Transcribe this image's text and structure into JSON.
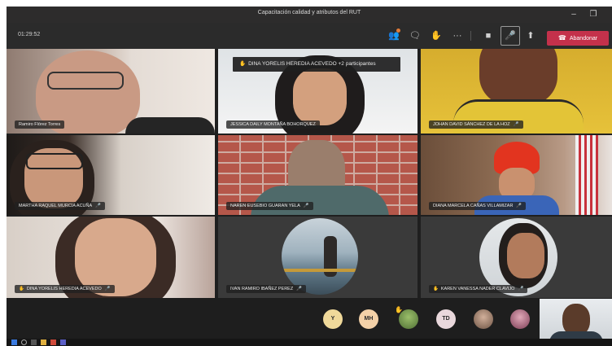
{
  "window": {
    "title": "Capacitación calidad y atributos del RUT"
  },
  "toolbar": {
    "timer": "01:29:52",
    "leave_label": "Abandonar",
    "leave_color": "#c4314b",
    "icons": [
      "participants-icon",
      "chat-icon",
      "raise-hand-icon",
      "more-options-icon",
      "camera-icon",
      "mic-off-icon",
      "share-screen-icon",
      "phone-icon"
    ]
  },
  "banner": {
    "text": "DINA YORELIS HEREDIA ACEVEDO +2 participantes"
  },
  "participants": [
    {
      "name": "Ramiro Flórez Torres",
      "muted": false,
      "hand": false
    },
    {
      "name": "JESSICA DAILY MONTAÑA BOHORQUEZ",
      "muted": false,
      "hand": false
    },
    {
      "name": "JOHAN DAVID SÁNCHEZ DE LA HOZ",
      "muted": true,
      "hand": false
    },
    {
      "name": "MARTHA RAQUEL MURCIA ACUÑA",
      "muted": true,
      "hand": false
    },
    {
      "name": "NAREN EUSEBIO GUARAN YELA",
      "muted": true,
      "hand": false
    },
    {
      "name": "DIANA MARCELA CAÑAS VILLAMIZAR",
      "muted": true,
      "hand": false
    },
    {
      "name": "DINA YORELIS HEREDIA ACEVEDO",
      "muted": true,
      "hand": true
    },
    {
      "name": "IVAN RAMIRO IBAÑEZ PEREZ",
      "muted": true,
      "hand": false
    },
    {
      "name": "KAREN VANESSA NADER CLAVIJO",
      "muted": true,
      "hand": true
    }
  ],
  "overflow_avatars": [
    {
      "initials": "Y",
      "color": "#f0d99a",
      "kind": "initials"
    },
    {
      "initials": "MH",
      "color": "#f3d1a8",
      "kind": "initials"
    },
    {
      "initials": "",
      "color": "#6f8f4a",
      "kind": "photo",
      "hand": true
    },
    {
      "initials": "TD",
      "color": "#e9d8dc",
      "kind": "initials"
    },
    {
      "initials": "",
      "color": "#a88a76",
      "kind": "photo"
    },
    {
      "initials": "",
      "color": "#c58fa2",
      "kind": "photo"
    }
  ]
}
